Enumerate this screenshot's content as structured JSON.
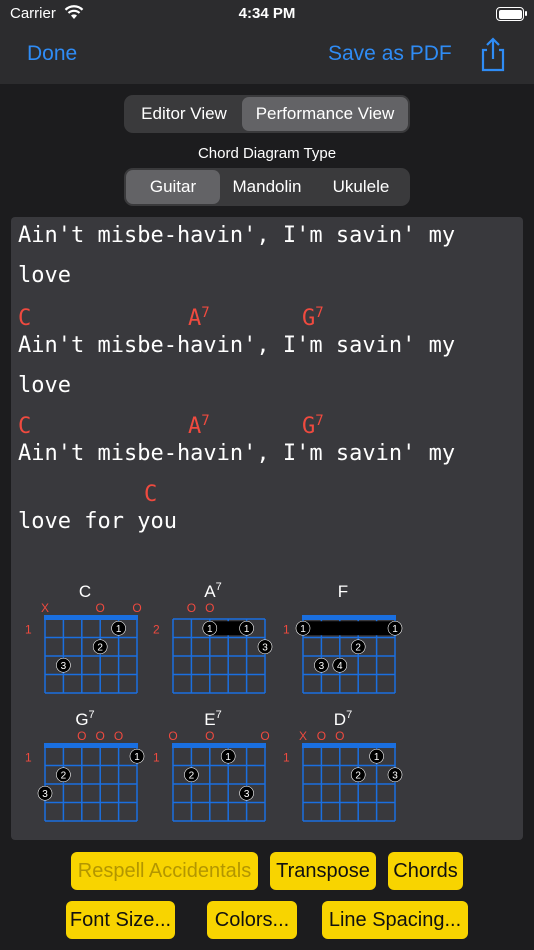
{
  "status": {
    "carrier": "Carrier",
    "time": "4:34 PM"
  },
  "nav": {
    "done": "Done",
    "save": "Save as PDF"
  },
  "views": {
    "editor": "Editor View",
    "performance": "Performance View",
    "active": "performance"
  },
  "diagram_type": {
    "caption": "Chord Diagram Type",
    "options": [
      "Guitar",
      "Mandolin",
      "Ukulele"
    ],
    "active": "Guitar"
  },
  "lyrics": {
    "lines": [
      "Ain't misbe-havin', I'm savin' my",
      "love",
      "Ain't misbe-havin', I'm savin' my",
      "love",
      "Ain't misbe-havin', I'm savin' my",
      "love for you"
    ],
    "chords": [
      {
        "name": "C",
        "sup": ""
      },
      {
        "name": "A",
        "sup": "7"
      },
      {
        "name": "G",
        "sup": "7"
      },
      {
        "name": "C",
        "sup": ""
      },
      {
        "name": "A",
        "sup": "7"
      },
      {
        "name": "G",
        "sup": "7"
      },
      {
        "name": "C",
        "sup": ""
      }
    ]
  },
  "diagrams": [
    {
      "name": "C",
      "sup": "",
      "fret": "1",
      "markers": [
        "X",
        "",
        "",
        "O",
        "",
        "O"
      ],
      "dots": [
        [
          "1",
          4,
          1
        ],
        [
          "2",
          3,
          2
        ],
        [
          "3",
          1,
          3
        ]
      ],
      "barre": null,
      "nut": true
    },
    {
      "name": "A",
      "sup": "7",
      "fret": "2",
      "markers": [
        "",
        "O",
        "O",
        "",
        "",
        ""
      ],
      "dots": [
        [
          "1",
          2,
          1
        ],
        [
          "1",
          4,
          1
        ],
        [
          "3",
          5,
          2
        ]
      ],
      "barre": [
        2,
        4,
        1
      ],
      "nut": false
    },
    {
      "name": "F",
      "sup": "",
      "fret": "1",
      "markers": [
        "",
        "",
        "",
        "",
        "",
        ""
      ],
      "dots": [
        [
          "1",
          0,
          1
        ],
        [
          "1",
          5,
          1
        ],
        [
          "2",
          3,
          2
        ],
        [
          "3",
          1,
          3
        ],
        [
          "4",
          2,
          3
        ]
      ],
      "barre": [
        0,
        5,
        1
      ],
      "nut": true
    },
    {
      "name": "G",
      "sup": "7",
      "fret": "1",
      "markers": [
        "",
        "",
        "O",
        "O",
        "O",
        ""
      ],
      "dots": [
        [
          "1",
          5,
          1
        ],
        [
          "2",
          1,
          2
        ],
        [
          "3",
          0,
          3
        ]
      ],
      "barre": null,
      "nut": true
    },
    {
      "name": "E",
      "sup": "7",
      "fret": "1",
      "markers": [
        "O",
        "",
        "O",
        "",
        "",
        "O"
      ],
      "dots": [
        [
          "1",
          3,
          1
        ],
        [
          "2",
          1,
          2
        ],
        [
          "3",
          4,
          3
        ]
      ],
      "barre": null,
      "nut": true
    },
    {
      "name": "D",
      "sup": "7",
      "fret": "1",
      "markers": [
        "X",
        "O",
        "O",
        "",
        "",
        ""
      ],
      "dots": [
        [
          "1",
          4,
          1
        ],
        [
          "2",
          3,
          2
        ],
        [
          "3",
          5,
          2
        ]
      ],
      "barre": null,
      "nut": true
    }
  ],
  "buttons": {
    "respell": "Respell Accidentals",
    "transpose": "Transpose",
    "chords": "Chords",
    "font_size": "Font Size...",
    "colors": "Colors...",
    "line_spacing": "Line Spacing..."
  },
  "colors": {
    "accent": "#2f8cf5",
    "chord": "#f04a3f",
    "button": "#f8d400",
    "grid": "#1a6fe0"
  }
}
